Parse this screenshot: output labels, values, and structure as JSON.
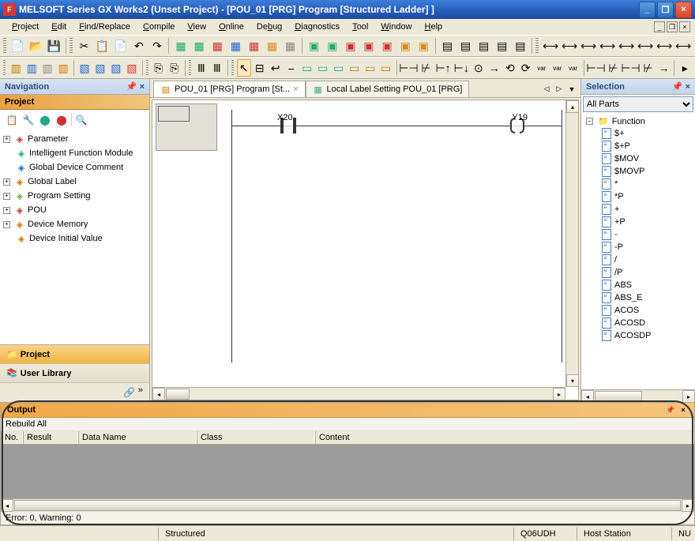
{
  "window": {
    "title": "MELSOFT Series GX Works2 (Unset Project) - [POU_01 [PRG] Program [Structured Ladder] ]"
  },
  "menu": {
    "items": [
      "Project",
      "Edit",
      "Find/Replace",
      "Compile",
      "View",
      "Online",
      "Debug",
      "Diagnostics",
      "Tool",
      "Window",
      "Help"
    ]
  },
  "navigation": {
    "panel_title": "Navigation",
    "project_header": "Project",
    "tree": [
      {
        "label": "Parameter",
        "expandable": true
      },
      {
        "label": "Intelligent Function Module",
        "expandable": false
      },
      {
        "label": "Global Device Comment",
        "expandable": false
      },
      {
        "label": "Global Label",
        "expandable": true
      },
      {
        "label": "Program Setting",
        "expandable": true
      },
      {
        "label": "POU",
        "expandable": true
      },
      {
        "label": "Device Memory",
        "expandable": true
      },
      {
        "label": "Device Initial Value",
        "expandable": false
      }
    ],
    "bottom_items": {
      "project": "Project",
      "user_library": "User Library"
    }
  },
  "tabs": {
    "active": "POU_01 [PRG] Program [St...",
    "inactive": "Local Label Setting POU_01 [PRG]"
  },
  "ladder": {
    "contact": "X20",
    "coil": "Y19"
  },
  "selection": {
    "panel_title": "Selection",
    "combo": "All Parts",
    "folder": "Function",
    "items": [
      "$+",
      "$+P",
      "$MOV",
      "$MOVP",
      "*",
      "*P",
      "+",
      "+P",
      "-",
      "-P",
      "/",
      "/P",
      "ABS",
      "ABS_E",
      "ACOS",
      "ACOSD",
      "ACOSDP"
    ]
  },
  "output": {
    "panel_title": "Output",
    "subheader": "Rebuild All",
    "columns": {
      "no": "No.",
      "result": "Result",
      "data_name": "Data Name",
      "class": "Class",
      "content": "Content"
    },
    "status": "Error: 0, Warning: 0"
  },
  "statusbar": {
    "mode": "Structured",
    "cpu": "Q06UDH",
    "station": "Host Station",
    "right": "NU"
  }
}
